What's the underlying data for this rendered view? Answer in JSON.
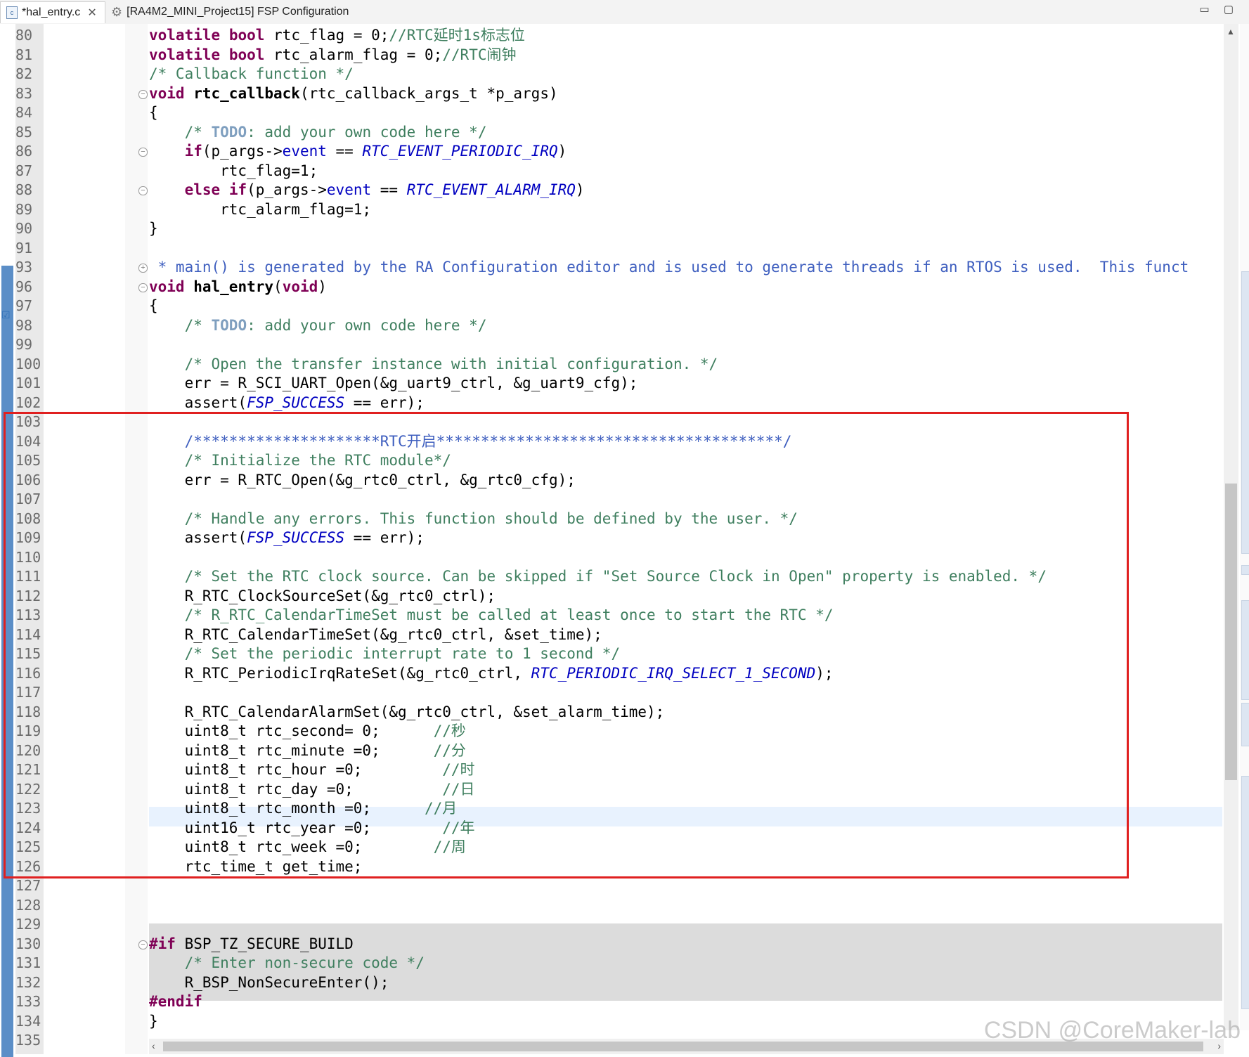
{
  "tabs": [
    {
      "label": "*hal_entry.c",
      "icon": "c-file-icon",
      "active": true
    },
    {
      "label": "[RA4M2_MINI_Project15] FSP Configuration",
      "icon": "gear-icon",
      "active": false
    }
  ],
  "window_controls": "▭ ▢",
  "watermark": "CSDN @CoreMaker-lab",
  "lines": [
    {
      "n": "80",
      "html": "<span class='kw'>volatile</span> <span class='kw'>bool</span> rtc_flag = 0;<span class='cm'>//RTC延时1s标志位</span>",
      "fold": ""
    },
    {
      "n": "81",
      "html": "<span class='kw'>volatile</span> <span class='kw'>bool</span> rtc_alarm_flag = 0;<span class='cm'>//RTC闹钟</span>",
      "fold": ""
    },
    {
      "n": "82",
      "html": "<span class='cm'>/* Callback function */</span>",
      "fold": ""
    },
    {
      "n": "83",
      "html": "<span class='kw'>void</span> <span class='fn'>rtc_callback</span>(rtc_callback_args_t *p_args)",
      "fold": "minus"
    },
    {
      "n": "84",
      "html": "{",
      "fold": ""
    },
    {
      "n": "85",
      "html": "    <span class='cm'>/* </span><span class='todo'>TODO</span><span class='cm'>: add your own code here */</span>",
      "fold": ""
    },
    {
      "n": "86",
      "html": "    <span class='kw'>if</span>(p_args-&gt;<span class='fld'>event</span> == <span class='en'>RTC_EVENT_PERIODIC_IRQ</span>)",
      "fold": "minus"
    },
    {
      "n": "87",
      "html": "        rtc_flag=1;",
      "fold": ""
    },
    {
      "n": "88",
      "html": "    <span class='kw'>else</span> <span class='kw'>if</span>(p_args-&gt;<span class='fld'>event</span> == <span class='en'>RTC_EVENT_ALARM_IRQ</span>)",
      "fold": "minus"
    },
    {
      "n": "89",
      "html": "        rtc_alarm_flag=1;",
      "fold": ""
    },
    {
      "n": "90",
      "html": "}",
      "fold": ""
    },
    {
      "n": "91",
      "html": "",
      "fold": ""
    },
    {
      "n": "93",
      "html": "<span class='doc'> * main() is generated by the RA Configuration editor and is used to generate threads if an RTOS is used.  This funct</span>",
      "fold": "plus"
    },
    {
      "n": "96",
      "html": "<span class='kw'>void</span> <span class='fn'>hal_entry</span>(<span class='kw'>void</span>)",
      "fold": "minus"
    },
    {
      "n": "97",
      "html": "{",
      "fold": ""
    },
    {
      "n": "98",
      "html": "    <span class='cm'>/* </span><span class='todo'>TODO</span><span class='cm'>: add your own code here */</span>",
      "fold": ""
    },
    {
      "n": "99",
      "html": "",
      "fold": ""
    },
    {
      "n": "100",
      "html": "    <span class='cm'>/* Open the transfer instance with initial configuration. */</span>",
      "fold": ""
    },
    {
      "n": "101",
      "html": "    err = R_SCI_UART_Open(&amp;g_uart9_ctrl, &amp;g_uart9_cfg);",
      "fold": ""
    },
    {
      "n": "102",
      "html": "    assert(<span class='en'>FSP_SUCCESS</span> == err);",
      "fold": ""
    },
    {
      "n": "103",
      "html": "",
      "fold": ""
    },
    {
      "n": "104",
      "html": "    <span class='doc'>/*********************RTC开启***************************************/</span>",
      "fold": ""
    },
    {
      "n": "105",
      "html": "    <span class='cm'>/* Initialize the RTC module*/</span>",
      "fold": ""
    },
    {
      "n": "106",
      "html": "    err = R_RTC_Open(&amp;g_rtc0_ctrl, &amp;g_rtc0_cfg);",
      "fold": ""
    },
    {
      "n": "107",
      "html": "",
      "fold": ""
    },
    {
      "n": "108",
      "html": "    <span class='cm'>/* Handle any errors. This function should be defined by the user. */</span>",
      "fold": ""
    },
    {
      "n": "109",
      "html": "    assert(<span class='en'>FSP_SUCCESS</span> == err);",
      "fold": ""
    },
    {
      "n": "110",
      "html": "",
      "fold": ""
    },
    {
      "n": "111",
      "html": "    <span class='cm'>/* Set the RTC clock source. Can be skipped if \"Set Source Clock in Open\" property is enabled. */</span>",
      "fold": ""
    },
    {
      "n": "112",
      "html": "    R_RTC_ClockSourceSet(&amp;g_rtc0_ctrl);",
      "fold": ""
    },
    {
      "n": "113",
      "html": "    <span class='cm'>/* R_RTC_CalendarTimeSet must be called at least once to start the RTC */</span>",
      "fold": ""
    },
    {
      "n": "114",
      "html": "    R_RTC_CalendarTimeSet(&amp;g_rtc0_ctrl, &amp;set_time);",
      "fold": ""
    },
    {
      "n": "115",
      "html": "    <span class='cm'>/* Set the periodic interrupt rate to 1 second */</span>",
      "fold": ""
    },
    {
      "n": "116",
      "html": "    R_RTC_PeriodicIrqRateSet(&amp;g_rtc0_ctrl, <span class='en'>RTC_PERIODIC_IRQ_SELECT_1_SECOND</span>);",
      "fold": ""
    },
    {
      "n": "117",
      "html": "",
      "fold": ""
    },
    {
      "n": "118",
      "html": "    R_RTC_CalendarAlarmSet(&amp;g_rtc0_ctrl, &amp;set_alarm_time);",
      "fold": ""
    },
    {
      "n": "119",
      "html": "    uint8_t rtc_second= 0;      <span class='cm'>//秒</span>",
      "fold": ""
    },
    {
      "n": "120",
      "html": "    uint8_t rtc_minute =0;      <span class='cm'>//分</span>",
      "fold": ""
    },
    {
      "n": "121",
      "html": "    uint8_t rtc_hour =0;         <span class='cm'>//时</span>",
      "fold": ""
    },
    {
      "n": "122",
      "html": "    uint8_t rtc_day =0;          <span class='cm'>//日</span>",
      "fold": ""
    },
    {
      "n": "123",
      "html": "    uint8_t rtc_month =0;      <span class='cm'>//月</span>",
      "fold": ""
    },
    {
      "n": "124",
      "html": "    uint16_t rtc_year =0;        <span class='cm'>//年</span>",
      "fold": ""
    },
    {
      "n": "125",
      "html": "    uint8_t rtc_week =0;        <span class='cm'>//周</span>",
      "fold": ""
    },
    {
      "n": "126",
      "html": "    rtc_time_t get_time;",
      "fold": ""
    },
    {
      "n": "127",
      "html": "",
      "fold": ""
    },
    {
      "n": "128",
      "html": "",
      "fold": ""
    },
    {
      "n": "129",
      "html": "",
      "fold": ""
    },
    {
      "n": "130",
      "html": "<span class='kw'>#if</span> BSP_TZ_SECURE_BUILD",
      "fold": "minus"
    },
    {
      "n": "131",
      "html": "    <span class='cm'>/* Enter non-secure code */</span>",
      "fold": ""
    },
    {
      "n": "132",
      "html": "    R_BSP_NonSecureEnter();",
      "fold": ""
    },
    {
      "n": "133",
      "html": "<span class='kw'>#endif</span>",
      "fold": ""
    },
    {
      "n": "134",
      "html": "}",
      "fold": ""
    },
    {
      "n": "135",
      "html": "",
      "fold": ""
    }
  ]
}
